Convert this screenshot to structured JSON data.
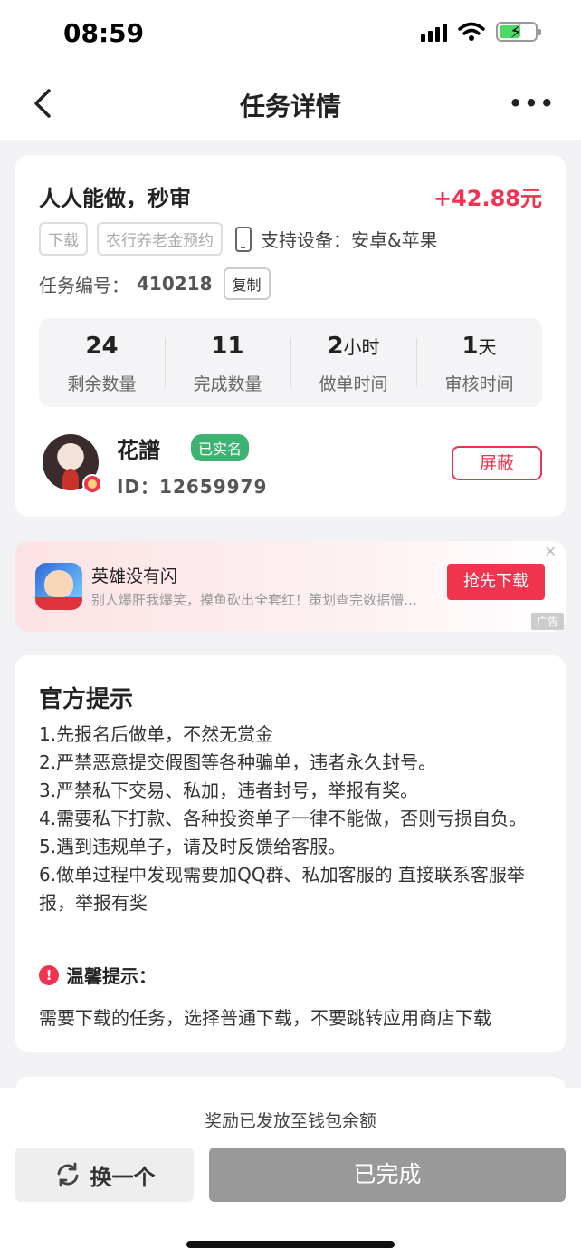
{
  "status_bar": {
    "time": "08:59"
  },
  "nav": {
    "title": "任务详情",
    "more": "•••"
  },
  "task": {
    "title": "人人能做，秒审",
    "reward": "+42.88元",
    "tags": [
      "下载",
      "农行养老金预约"
    ],
    "device_label": "支持设备：安卓&苹果",
    "task_no_label": "任务编号：",
    "task_no": "410218",
    "copy_label": "复制",
    "stats": [
      {
        "value": "24",
        "unit": "",
        "label": "剩余数量"
      },
      {
        "value": "11",
        "unit": "",
        "label": "完成数量"
      },
      {
        "value": "2",
        "unit": "小时",
        "label": "做单时间"
      },
      {
        "value": "1",
        "unit": "天",
        "label": "审核时间"
      }
    ]
  },
  "publisher": {
    "name": "花譜",
    "verified": "已实名",
    "id_text": "ID：12659979",
    "block_label": "屏蔽"
  },
  "ad": {
    "title": "英雄没有闪",
    "desc": "别人爆肝我爆笑，摸鱼砍出全套红！策划查完数据懵…",
    "cta": "抢先下载",
    "close": "✕",
    "label": "广告"
  },
  "tips": {
    "title": "官方提示",
    "items": [
      "1.先报名后做单，不然无赏金",
      "2.严禁恶意提交假图等各种骗单，违者永久封号。",
      "3.严禁私下交易、私加，违者封号，举报有奖。",
      "4.需要私下打款、各种投资单子一律不能做，否则亏损自负。",
      "5.遇到违规单子，请及时反馈给客服。",
      "6.做单过程中发现需要加QQ群、私加客服的 直接联系客服举报，举报有奖"
    ],
    "warm_title": "温馨提示：",
    "warm_icon": "!",
    "warm_text": "需要下载的任务，选择普通下载，不要跳转应用商店下载"
  },
  "bottom": {
    "reward_note": "奖励已发放至钱包余额",
    "switch_label": "换一个",
    "done_label": "已完成"
  },
  "colors": {
    "accent": "#f0334e",
    "verified": "#3cb371",
    "disabled": "#999999"
  },
  "icons": [
    "back-icon",
    "more-icon",
    "signal-icon",
    "wifi-icon",
    "battery-icon",
    "device-icon",
    "refresh-icon",
    "warning-icon",
    "close-icon"
  ]
}
